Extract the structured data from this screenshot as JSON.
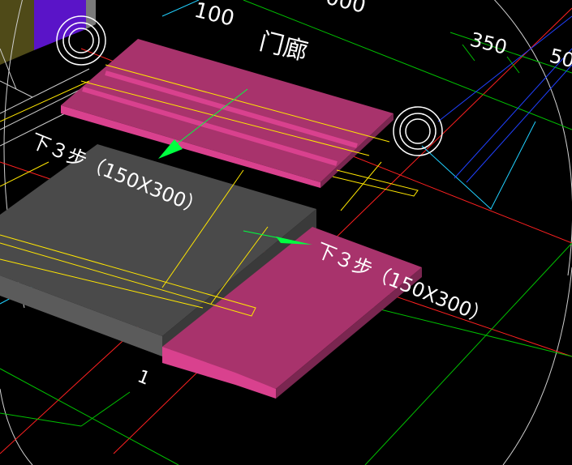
{
  "viewport": {
    "background": "#000000",
    "colors": {
      "slab_top": "#4a4a4a",
      "slab_side": "#5b5b5b",
      "step_top": "#a8336c",
      "step_side": "#d9418e",
      "column_gray": "#7a7a7a",
      "olive_block": "#4f4a18",
      "purple_block": "#5a14c8",
      "line_red": "#ff2020",
      "line_yellow": "#ffe600",
      "line_green": "#00c000",
      "line_cyan": "#20d0ff",
      "line_blue": "#2040ff",
      "line_white": "#cfcfcf",
      "arrow_green": "#00ff40"
    }
  },
  "labels": {
    "top_dim_100": "100",
    "top_dim_000": "000",
    "porch": "门廊",
    "dim_350": "350",
    "dim_right": "50",
    "stair_upper": "下３步（150X300）",
    "stair_lower": "下３步（150X300）",
    "axis_mark": "1"
  }
}
